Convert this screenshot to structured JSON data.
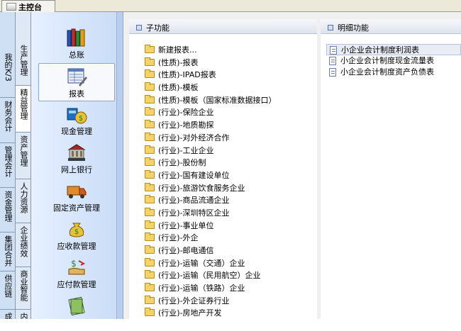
{
  "top_tab": {
    "label": "主控台"
  },
  "vertical_tabs_col1": [
    {
      "label": "我的K/3"
    },
    {
      "label": "财务会计"
    },
    {
      "label": "管理会计"
    },
    {
      "label": "资金管理"
    },
    {
      "label": "集团合并"
    },
    {
      "label": "供应链"
    },
    {
      "label": "成本"
    }
  ],
  "vertical_tabs_col2": [
    {
      "label": "生产管理"
    },
    {
      "label": "精益管理"
    },
    {
      "label": "资产管理"
    },
    {
      "label": "人力资源"
    },
    {
      "label": "企业绩效"
    },
    {
      "label": "商业智能"
    },
    {
      "label": "内控"
    }
  ],
  "nav_items": [
    {
      "label": "总账",
      "icon": "books-icon"
    },
    {
      "label": "报表",
      "icon": "report-icon",
      "active": true
    },
    {
      "label": "现金管理",
      "icon": "cash-bag-icon"
    },
    {
      "label": "网上银行",
      "icon": "bank-icon"
    },
    {
      "label": "固定资产管理",
      "icon": "truck-icon"
    },
    {
      "label": "应收款管理",
      "icon": "money-bag-icon"
    },
    {
      "label": "应付款管理",
      "icon": "money-hand-icon"
    }
  ],
  "sub_header": {
    "label": "子功能"
  },
  "detail_header": {
    "label": "明细功能"
  },
  "sub_functions": [
    "新建报表...",
    "(性质)-报表",
    "(性质)-IPAD报表",
    "(性质)-模板",
    "(性质)-模板（国家标准数据接口）",
    "(行业)-保险企业",
    "(行业)-地质勘探",
    "(行业)-对外经济合作",
    "(行业)-工业企业",
    "(行业)-股份制",
    "(行业)-国有建设单位",
    "(行业)-旅游饮食服务企业",
    "(行业)-商品流通企业",
    "(行业)-深圳特区企业",
    "(行业)-事业单位",
    "(行业)-外企",
    "(行业)-邮电通信",
    "(行业)-运输（交通）企业",
    "(行业)-运输（民用航空）企业",
    "(行业)-运输（铁路）企业",
    "(行业)-外企证券行业",
    "(行业)-房地产开发"
  ],
  "detail_functions": [
    {
      "label": "小企业会计制度利润表",
      "selected": true
    },
    {
      "label": "小企业会计制度现金流量表"
    },
    {
      "label": "小企业会计制度资产负债表"
    }
  ]
}
